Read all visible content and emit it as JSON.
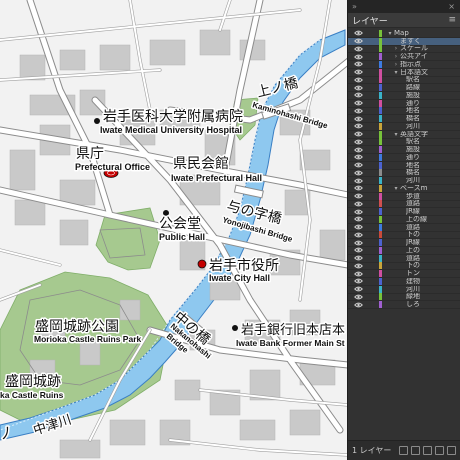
{
  "map": {
    "labels": {
      "iwate_med_jp": "岩手医科大学附属病院",
      "iwate_med_en": "Iwate Medical University Hospital",
      "kencho_jp": "県庁",
      "kencho_en": "Prefectural Office",
      "kenmin_jp": "県民会館",
      "kenmin_en": "Iwate Prefectural Hall",
      "kamino_jp": "上ノ橋",
      "kamino_en": "Kaminohashi Bridge",
      "yonoji_jp": "与の字橋",
      "yonoji_en": "Yonojibashi Bridge",
      "kokaido_jp": "公会堂",
      "kokaido_en": "Public Hall",
      "cityhall_jp": "岩手市役所",
      "cityhall_en": "Iwate City Hall",
      "nakano_jp": "中の橋",
      "nakano_en1": "Nakanohashi",
      "nakano_en2": "Bridge",
      "bank_jp": "岩手銀行旧本店本",
      "bank_en": "Iwate Bank Former Main St",
      "park_jp": "盛岡城跡公園",
      "park_en": "Morioka Castle Ruins Park",
      "castle_jp": "盛岡城跡",
      "castle_en": "ka Castle Ruins",
      "river_jp": "中津川",
      "bottom_jp": "ノ"
    },
    "colors": {
      "background": "#f2f2f2",
      "road": "#ffffff",
      "road_casing": "#8c8c8c",
      "building": "#c9c9c9",
      "park": "#a6c98f",
      "water": "#8ec8ef",
      "water_edge": "#3a7fc4",
      "marker": "#c40000"
    }
  },
  "layers_panel": {
    "title": "レイヤー",
    "menu_icon": "hamburger-menu-icon",
    "footer_count": "1 レイヤー",
    "colors": {
      "panel_bg": "#323232",
      "selected_row": "#46607e"
    },
    "rows": [
      {
        "name": "Map",
        "indent": 0,
        "arrow": "▾",
        "color": "#77c23a",
        "selected": false
      },
      {
        "name": "ますく",
        "indent": 1,
        "arrow": "",
        "color": "#77c23a",
        "selected": true
      },
      {
        "name": "スケール",
        "indent": 1,
        "arrow": "›",
        "color": "#77c23a",
        "selected": false
      },
      {
        "name": "公共アイ",
        "indent": 1,
        "arrow": "›",
        "color": "#a05fd0",
        "selected": false
      },
      {
        "name": "指示点",
        "indent": 1,
        "arrow": "›",
        "color": "#3d7be0",
        "selected": false
      },
      {
        "name": "日本語文",
        "indent": 1,
        "arrow": "▾",
        "color": "#d04fa0",
        "selected": false
      },
      {
        "name": "駅名",
        "indent": 2,
        "arrow": "",
        "color": "#d04fa0",
        "selected": false
      },
      {
        "name": "路線",
        "indent": 2,
        "arrow": "",
        "color": "#4c62d0",
        "selected": false
      },
      {
        "name": "施設",
        "indent": 2,
        "arrow": "",
        "color": "#3ab3c8",
        "selected": false
      },
      {
        "name": "通り",
        "indent": 2,
        "arrow": "",
        "color": "#d04fa0",
        "selected": false
      },
      {
        "name": "地名",
        "indent": 2,
        "arrow": "",
        "color": "#4c62d0",
        "selected": false
      },
      {
        "name": "橋名",
        "indent": 2,
        "arrow": "",
        "color": "#3ab3c8",
        "selected": false
      },
      {
        "name": "河川",
        "indent": 2,
        "arrow": "",
        "color": "#c8a53a",
        "selected": false
      },
      {
        "name": "英語文字",
        "indent": 1,
        "arrow": "▾",
        "color": "#77c23a",
        "selected": false
      },
      {
        "name": "駅名",
        "indent": 2,
        "arrow": "",
        "color": "#77c23a",
        "selected": false
      },
      {
        "name": "施設",
        "indent": 2,
        "arrow": "",
        "color": "#a05fd0",
        "selected": false
      },
      {
        "name": "通り",
        "indent": 2,
        "arrow": "",
        "color": "#3d7be0",
        "selected": false
      },
      {
        "name": "地名",
        "indent": 2,
        "arrow": "",
        "color": "#4c62d0",
        "selected": false
      },
      {
        "name": "橋名",
        "indent": 2,
        "arrow": "",
        "color": "#8c8c8c",
        "selected": false
      },
      {
        "name": "河川",
        "indent": 2,
        "arrow": "",
        "color": "#3ab3c8",
        "selected": false
      },
      {
        "name": "ベースm",
        "indent": 1,
        "arrow": "▾",
        "color": "#c8a53a",
        "selected": false
      },
      {
        "name": "歩道",
        "indent": 2,
        "arrow": "",
        "color": "#d04fa0",
        "selected": false
      },
      {
        "name": "道路",
        "indent": 2,
        "arrow": "",
        "color": "#d04f4f",
        "selected": false
      },
      {
        "name": "JR線",
        "indent": 2,
        "arrow": "",
        "color": "#4c62d0",
        "selected": false
      },
      {
        "name": "上の線",
        "indent": 2,
        "arrow": "",
        "color": "#77c23a",
        "selected": false
      },
      {
        "name": "道路",
        "indent": 2,
        "arrow": "",
        "color": "#3d7be0",
        "selected": false
      },
      {
        "name": "下の",
        "indent": 2,
        "arrow": "",
        "color": "#c84a3a",
        "selected": false
      },
      {
        "name": "JR線",
        "indent": 2,
        "arrow": "",
        "color": "#4c62d0",
        "selected": false
      },
      {
        "name": "上の",
        "indent": 2,
        "arrow": "",
        "color": "#a05fd0",
        "selected": false
      },
      {
        "name": "道路",
        "indent": 2,
        "arrow": "",
        "color": "#3ab3c8",
        "selected": false
      },
      {
        "name": "下の",
        "indent": 2,
        "arrow": "",
        "color": "#c8a53a",
        "selected": false
      },
      {
        "name": "トン",
        "indent": 2,
        "arrow": "",
        "color": "#d04fa0",
        "selected": false
      },
      {
        "name": "建物",
        "indent": 2,
        "arrow": "",
        "color": "#4c62d0",
        "selected": false
      },
      {
        "name": "河川",
        "indent": 2,
        "arrow": "",
        "color": "#3ab3c8",
        "selected": false
      },
      {
        "name": "緑地",
        "indent": 2,
        "arrow": "",
        "color": "#77c23a",
        "selected": false
      },
      {
        "name": "しろ",
        "indent": 2,
        "arrow": "",
        "color": "#a05fd0",
        "selected": false
      }
    ]
  }
}
